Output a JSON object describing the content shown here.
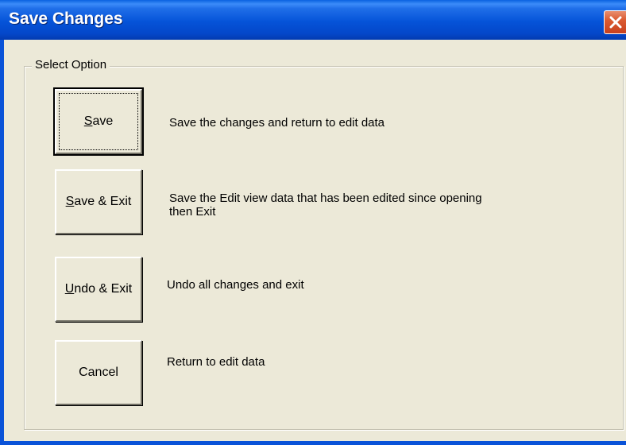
{
  "window": {
    "title": "Save Changes"
  },
  "group": {
    "legend": "Select Option"
  },
  "options": [
    {
      "label_first": "S",
      "label_rest": "ave",
      "description_line1": "Save the changes and return to edit data",
      "description_line2": ""
    },
    {
      "label_first": "S",
      "label_rest": "ave & Exit",
      "description_line1": "Save the Edit view data that has been edited since opening",
      "description_line2": "then Exit"
    },
    {
      "label_first": "U",
      "label_rest": "ndo & Exit",
      "description_line1": "Undo all changes and exit",
      "description_line2": ""
    },
    {
      "label_first": "",
      "label_rest": "Cancel",
      "description_line1": "Return to edit data",
      "description_line2": ""
    }
  ],
  "icons": {
    "close": "close-icon"
  },
  "colors": {
    "titlebar": "#0553d8",
    "dialog_face": "#ece9d8",
    "close_button": "#db5b32"
  }
}
